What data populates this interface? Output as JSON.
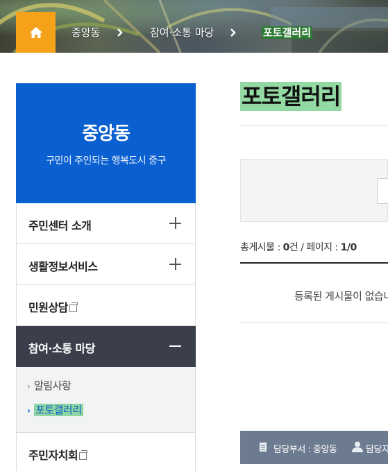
{
  "breadcrumb": {
    "home_icon": "home-icon",
    "items": [
      "중앙동",
      "참여·소통 마당",
      "포토갤러리"
    ]
  },
  "sidebar": {
    "title": "중앙동",
    "subtitle": "구민이 주인되는 행복도시 중구",
    "header_color": "#0a5fd1",
    "menu": [
      {
        "label": "주민센터 소개",
        "icon": "plus-icon"
      },
      {
        "label": "생활정보서비스",
        "icon": "plus-icon"
      },
      {
        "label": "민원상담",
        "icon": "new-window-icon"
      },
      {
        "label": "참여·소통 마당",
        "icon": "minus-icon",
        "active": true
      },
      {
        "label": "주민자치회",
        "icon": "new-window-icon"
      }
    ],
    "submenu": [
      {
        "label": "알림사항"
      },
      {
        "label": "포토갤러리",
        "current": true
      }
    ]
  },
  "main": {
    "title": "포토갤러리",
    "count_prefix": "총게시물 : ",
    "count_value": "0",
    "count_mid": "건 / 페이지 : ",
    "page_value": "1/0",
    "empty_message": "등록된 게시물이 없습니다.",
    "footer": {
      "dept": "담당부서 : 중앙동",
      "contact": "담당자 :"
    }
  },
  "colors": {
    "home_button": "#f5a11a",
    "active_menu": "#3a3f4b",
    "footer_bar": "#6d7b90",
    "highlight": "#93d9a4"
  }
}
